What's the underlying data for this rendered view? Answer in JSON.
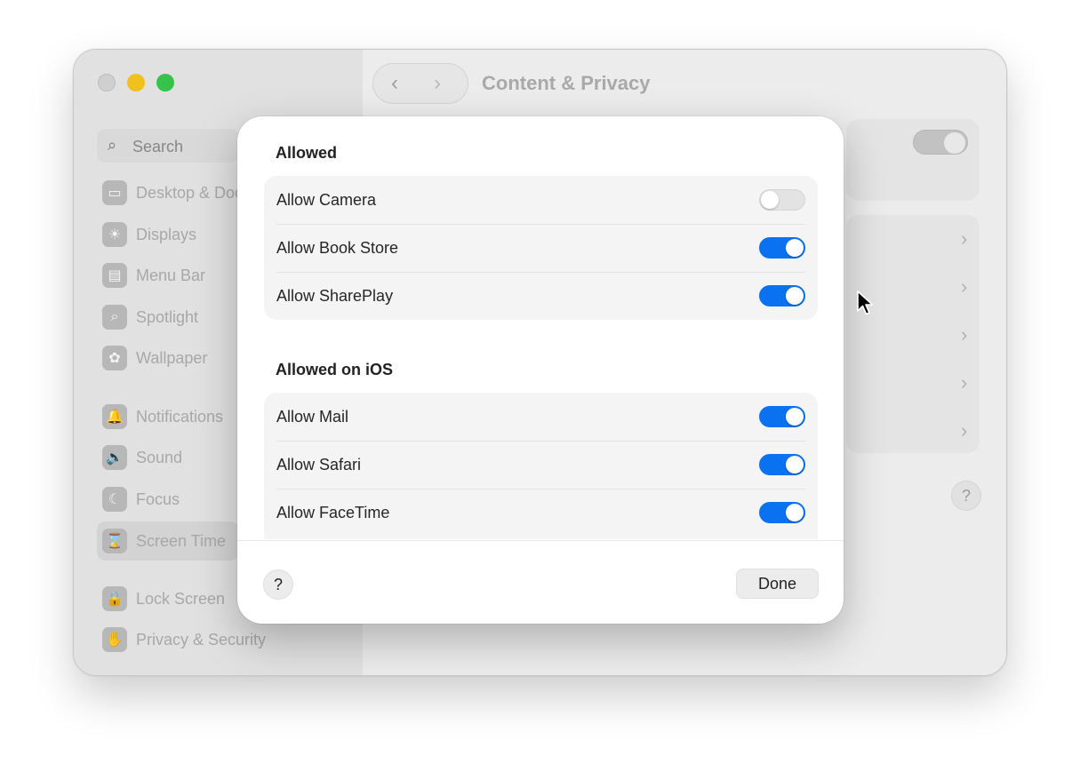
{
  "window": {
    "title": "Content & Privacy",
    "nav": {
      "back_glyph": "‹",
      "forward_glyph": "›"
    }
  },
  "sidebar": {
    "search_placeholder": "Search",
    "items": [
      {
        "label": "Desktop & Dock",
        "icon": "dock-icon",
        "glyph": "▭"
      },
      {
        "label": "Displays",
        "icon": "sun-icon",
        "glyph": "☀"
      },
      {
        "label": "Menu Bar",
        "icon": "menu-bar-icon",
        "glyph": "▤"
      },
      {
        "label": "Spotlight",
        "icon": "magnifier-icon",
        "glyph": "⌕"
      },
      {
        "label": "Wallpaper",
        "icon": "flower-icon",
        "glyph": "✿"
      },
      {
        "label": "Notifications",
        "icon": "bell-icon",
        "glyph": "🔔"
      },
      {
        "label": "Sound",
        "icon": "speaker-icon",
        "glyph": "🔊"
      },
      {
        "label": "Focus",
        "icon": "moon-icon",
        "glyph": "☾"
      },
      {
        "label": "Screen Time",
        "icon": "hourglass-icon",
        "glyph": "⌛"
      },
      {
        "label": "Lock Screen",
        "icon": "lock-icon",
        "glyph": "🔒"
      },
      {
        "label": "Privacy & Security",
        "icon": "hand-icon",
        "glyph": "✋"
      }
    ]
  },
  "dialog": {
    "sections": [
      {
        "title": "Allowed",
        "items": [
          {
            "label": "Allow Camera",
            "enabled": false
          },
          {
            "label": "Allow Book Store",
            "enabled": true
          },
          {
            "label": "Allow SharePlay",
            "enabled": true
          }
        ]
      },
      {
        "title": "Allowed on iOS",
        "items": [
          {
            "label": "Allow Mail",
            "enabled": true
          },
          {
            "label": "Allow Safari",
            "enabled": true
          },
          {
            "label": "Allow FaceTime",
            "enabled": true
          }
        ]
      }
    ],
    "help_label": "?",
    "done_label": "Done"
  },
  "background_help_label": "?",
  "colors": {
    "accent": "#0a72f0",
    "toggle_off": "#e3e3e4",
    "traffic_yellow": "#f0c11d",
    "traffic_green": "#37c24b"
  }
}
